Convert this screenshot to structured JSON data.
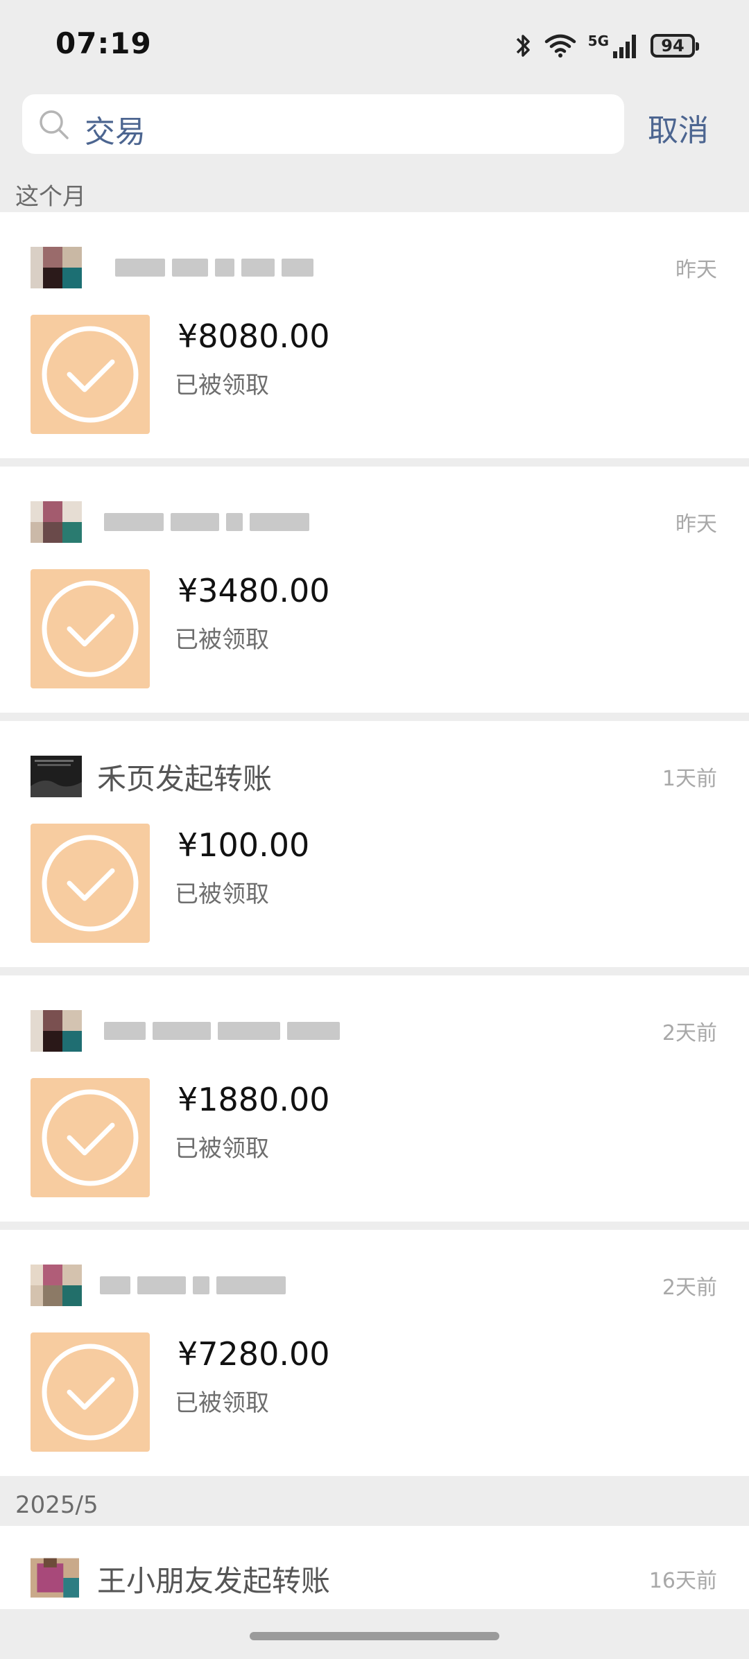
{
  "status_bar": {
    "time": "07:19",
    "network": "5G",
    "battery": "94"
  },
  "search": {
    "query": "交易",
    "cancel_label": "取消"
  },
  "sections": [
    {
      "label": "这个月"
    },
    {
      "label": "2025/5"
    }
  ],
  "transactions": [
    {
      "title": "",
      "time": "昨天",
      "amount": "¥8080.00",
      "status": "已被领取"
    },
    {
      "title": "",
      "time": "昨天",
      "amount": "¥3480.00",
      "status": "已被领取"
    },
    {
      "title": "禾页发起转账",
      "time": "1天前",
      "amount": "¥100.00",
      "status": "已被领取"
    },
    {
      "title": "",
      "time": "2天前",
      "amount": "¥1880.00",
      "status": "已被领取"
    },
    {
      "title": "",
      "time": "2天前",
      "amount": "¥7280.00",
      "status": "已被领取"
    },
    {
      "title": "王小朋友发起转账",
      "time": "16天前"
    }
  ],
  "colors": {
    "accent": "#4c6590",
    "redpacket_bg": "#f7cca0",
    "page_bg": "#ededed"
  }
}
